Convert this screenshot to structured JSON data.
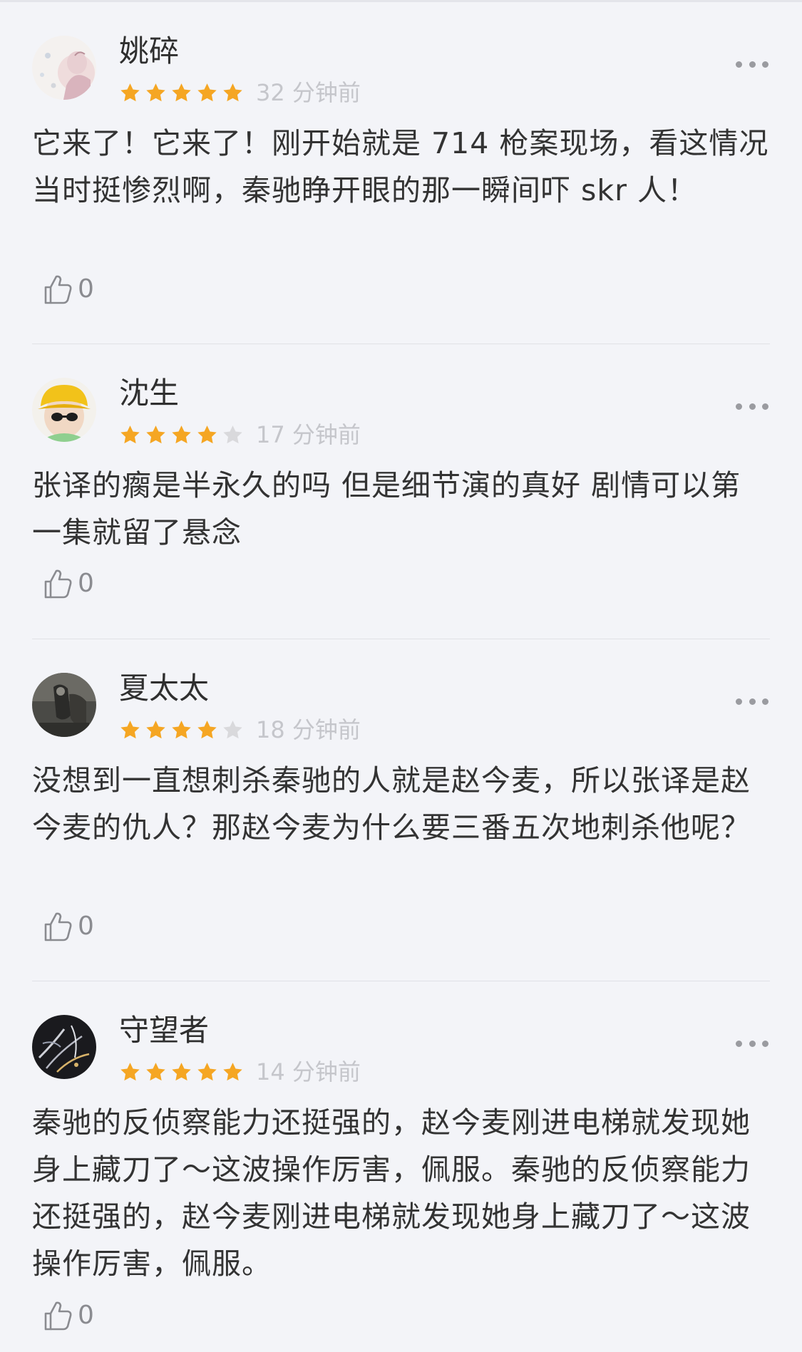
{
  "comments": [
    {
      "username": "姚碎",
      "rating": 5,
      "time": "32 分钟前",
      "text": "它来了！它来了！刚开始就是 714 枪案现场，看这情况当时挺惨烈啊，秦驰睁开眼的那一瞬间吓 skr 人！",
      "likes": "0",
      "avatar_icon": "floral-portrait-avatar"
    },
    {
      "username": "沈生",
      "rating": 4,
      "time": "17 分钟前",
      "text": "张译的瘸是半永久的吗 但是细节演的真好 剧情可以第一集就留了悬念",
      "likes": "0",
      "avatar_icon": "child-yellow-hat-avatar"
    },
    {
      "username": "夏太太",
      "rating": 4,
      "time": "18 分钟前",
      "text": "没想到一直想刺杀秦驰的人就是赵今麦，所以张译是赵今麦的仇人？那赵今麦为什么要三番五次地刺杀他呢？",
      "likes": "0",
      "avatar_icon": "dark-photo-avatar"
    },
    {
      "username": "守望者",
      "rating": 5,
      "time": "14 分钟前",
      "text": "秦驰的反侦察能力还挺强的，赵今麦刚进电梯就发现她身上藏刀了～这波操作厉害，佩服。秦驰的反侦察能力还挺强的，赵今麦刚进电梯就发现她身上藏刀了～这波操作厉害，佩服。",
      "likes": "0",
      "avatar_icon": "dark-feathers-avatar"
    }
  ],
  "colors": {
    "background": "#f3f4f8",
    "star_filled": "#f5a623",
    "star_empty": "#d9d9dc",
    "time_text": "#c5c6cb",
    "body_text": "#333333",
    "like_icon": "#8a8b90"
  },
  "icons": {
    "more": "more-dots-icon",
    "like": "thumbs-up-icon",
    "star": "star-icon"
  }
}
